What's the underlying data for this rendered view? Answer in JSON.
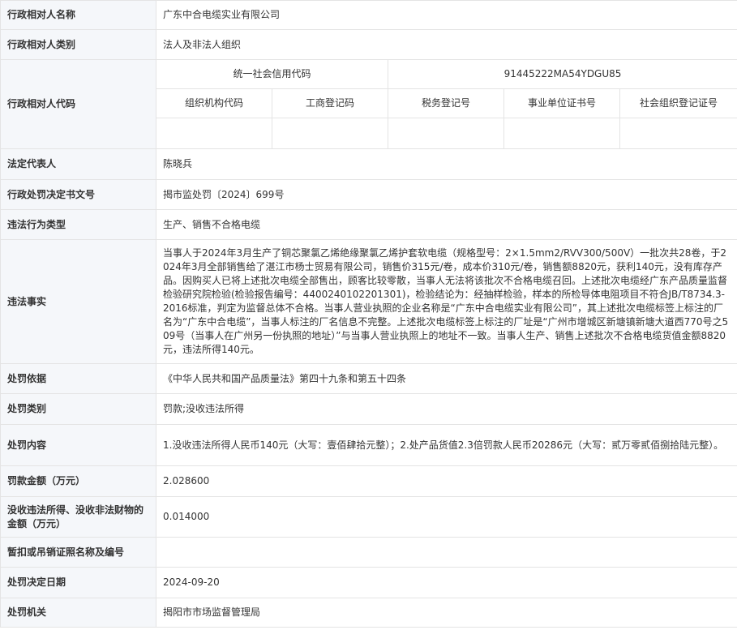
{
  "rows": {
    "name": {
      "label": "行政相对人名称",
      "value": "广东中合电缆实业有限公司"
    },
    "category": {
      "label": "行政相对人类别",
      "value": "法人及非法人组织"
    },
    "code": {
      "label": "行政相对人代码",
      "credit_code_label": "统一社会信用代码",
      "credit_code_value": "91445222MA54YDGU85",
      "org_code_label": "组织机构代码",
      "biz_reg_label": "工商登记码",
      "tax_reg_label": "税务登记号",
      "inst_cert_label": "事业单位证书号",
      "social_org_label": "社会组织登记证号",
      "org_code_value": "",
      "biz_reg_value": "",
      "tax_reg_value": "",
      "inst_cert_value": "",
      "social_org_value": ""
    },
    "legal_rep": {
      "label": "法定代表人",
      "value": "陈晓兵"
    },
    "doc_no": {
      "label": "行政处罚决定书文号",
      "value": "揭市监处罚〔2024〕699号"
    },
    "violation_type": {
      "label": "违法行为类型",
      "value": "生产、销售不合格电缆"
    },
    "facts": {
      "label": "违法事实",
      "value": "当事人于2024年3月生产了铜芯聚氯乙烯绝缘聚氯乙烯护套软电缆（规格型号：2×1.5mm2/RVV300/500V）一批次共28卷，于2024年3月全部销售给了湛江市杨士贸易有限公司，销售价315元/卷，成本价310元/卷，销售额8820元，获利140元，没有库存产品。因购买人已将上述批次电缆全部售出，顾客比较零散，当事人无法将该批次不合格电缆召回。上述批次电缆经广东产品质量监督检验研究院检验(检验报告编号：4400240102201301)，检验结论为：经抽样检验，样本的所检导体电阻项目不符合JB/T8734.3-2016标准，判定为监督总体不合格。当事人营业执照的企业名称是“广东中合电缆实业有限公司”，其上述批次电缆标签上标注的厂名为“广东中合电缆”，当事人标注的厂名信息不完整。上述批次电缆标签上标注的厂址是“广州市增城区新塘镇新塘大道西770号之509号（当事人在广州另一份执照的地址）”与当事人营业执照上的地址不一致。当事人生产、销售上述批次不合格电缆货值金额8820元，违法所得140元。"
    },
    "basis": {
      "label": "处罚依据",
      "value": "《中华人民共和国产品质量法》第四十九条和第五十四条"
    },
    "penalty_type": {
      "label": "处罚类别",
      "value": "罚款;没收违法所得"
    },
    "penalty_content": {
      "label": "处罚内容",
      "value": "1.没收违法所得人民币140元（大写：壹佰肆拾元整）；2.处产品货值2.3倍罚款人民币20286元（大写：贰万零贰佰捌拾陆元整）。"
    },
    "fine": {
      "label": "罚款金额（万元）",
      "value": "2.028600"
    },
    "confiscation": {
      "label": "没收违法所得、没收非法财物的金额（万元）",
      "value": "0.014000"
    },
    "license": {
      "label": "暂扣或吊销证照名称及编号",
      "value": ""
    },
    "decision_date": {
      "label": "处罚决定日期",
      "value": "2024-09-20"
    },
    "authority": {
      "label": "处罚机关",
      "value": "揭阳市市场监督管理局"
    }
  }
}
